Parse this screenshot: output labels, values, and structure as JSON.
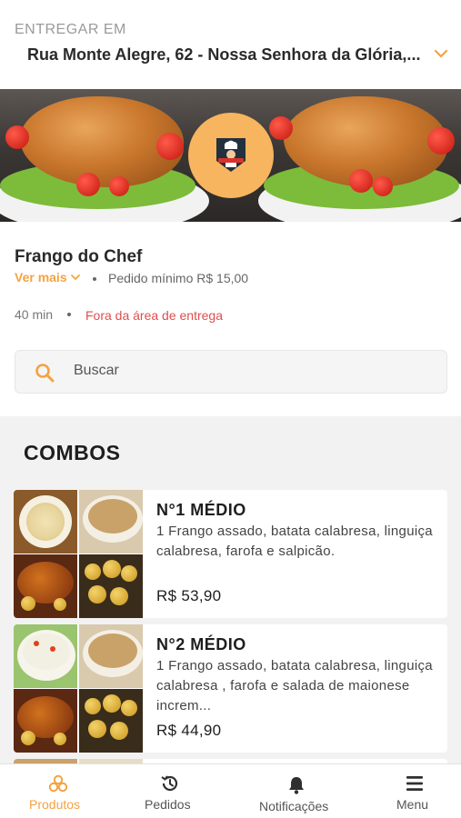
{
  "delivery": {
    "label": "ENTREGAR EM",
    "address": "Rua Monte Alegre, 62 - Nossa Senhora da Glória,..."
  },
  "store": {
    "name": "Frango do Chef",
    "see_more": "Ver mais",
    "min_order": "Pedido mínimo R$ 15,00",
    "eta": "40 min",
    "delivery_status": "Fora da área de entrega"
  },
  "search": {
    "placeholder": "Buscar"
  },
  "section": {
    "title": "COMBOS"
  },
  "products": [
    {
      "title": "N°1 MÉDIO",
      "description": "1 Frango assado, batata calabresa, linguiça calabresa, farofa e salpicão.",
      "price": "R$ 53,90"
    },
    {
      "title": "N°2 MÉDIO",
      "description": "1 Frango assado, batata calabresa, linguiça calabresa , farofa e salada de maionese increm...",
      "price": "R$ 44,90"
    }
  ],
  "nav": {
    "items": [
      {
        "label": "Produtos",
        "icon": "products-icon",
        "active": true
      },
      {
        "label": "Pedidos",
        "icon": "history-icon",
        "active": false
      },
      {
        "label": "Notificações",
        "icon": "bell-icon",
        "active": false
      },
      {
        "label": "Menu",
        "icon": "hamburger-icon",
        "active": false
      }
    ]
  },
  "colors": {
    "accent": "#f5a340",
    "alert": "#e04e4e",
    "logo_bg": "#f7b55f"
  }
}
